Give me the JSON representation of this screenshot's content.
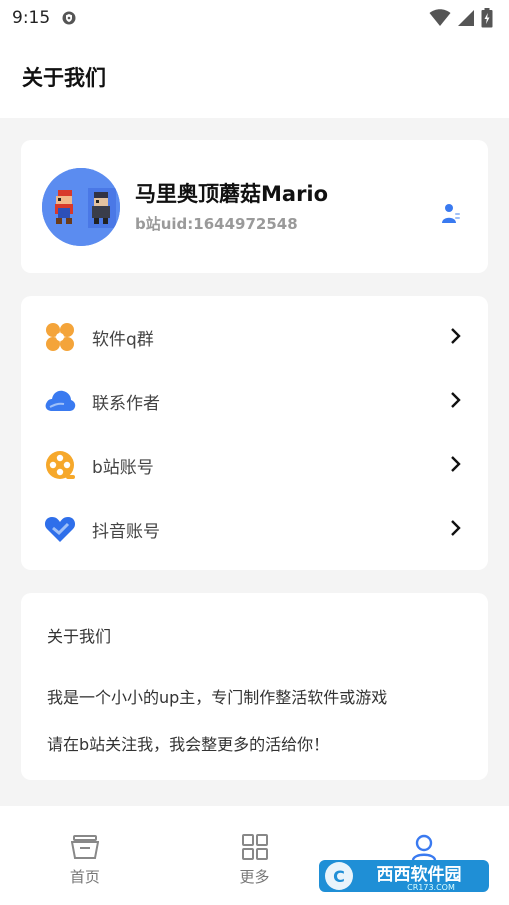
{
  "status": {
    "time": "9:15"
  },
  "header": {
    "title": "关于我们"
  },
  "profile": {
    "name": "马里奥顶蘑菇Mario",
    "uid": "b站uid:1644972548"
  },
  "menu": {
    "items": [
      {
        "label": "软件q群",
        "icon": "apps-icon",
        "color": "#f4a43a"
      },
      {
        "label": "联系作者",
        "icon": "cloud-icon",
        "color": "#3a7af0"
      },
      {
        "label": "b站账号",
        "icon": "film-reel-icon",
        "color": "#f6a82b"
      },
      {
        "label": "抖音账号",
        "icon": "heart-chat-icon",
        "color": "#2f6fea"
      }
    ]
  },
  "about": {
    "heading": "关于我们",
    "line1": "我是一个小小的up主，专门制作整活软件或游戏",
    "line2": "请在b站关注我，我会整更多的活给你！"
  },
  "nav": {
    "home": "首页",
    "more": "更多"
  },
  "watermark": {
    "text": "西西软件园",
    "domain": "CR173.COM"
  },
  "colors": {
    "accent": "#3a7af0",
    "avatar_bg": "#5b8cf0"
  }
}
